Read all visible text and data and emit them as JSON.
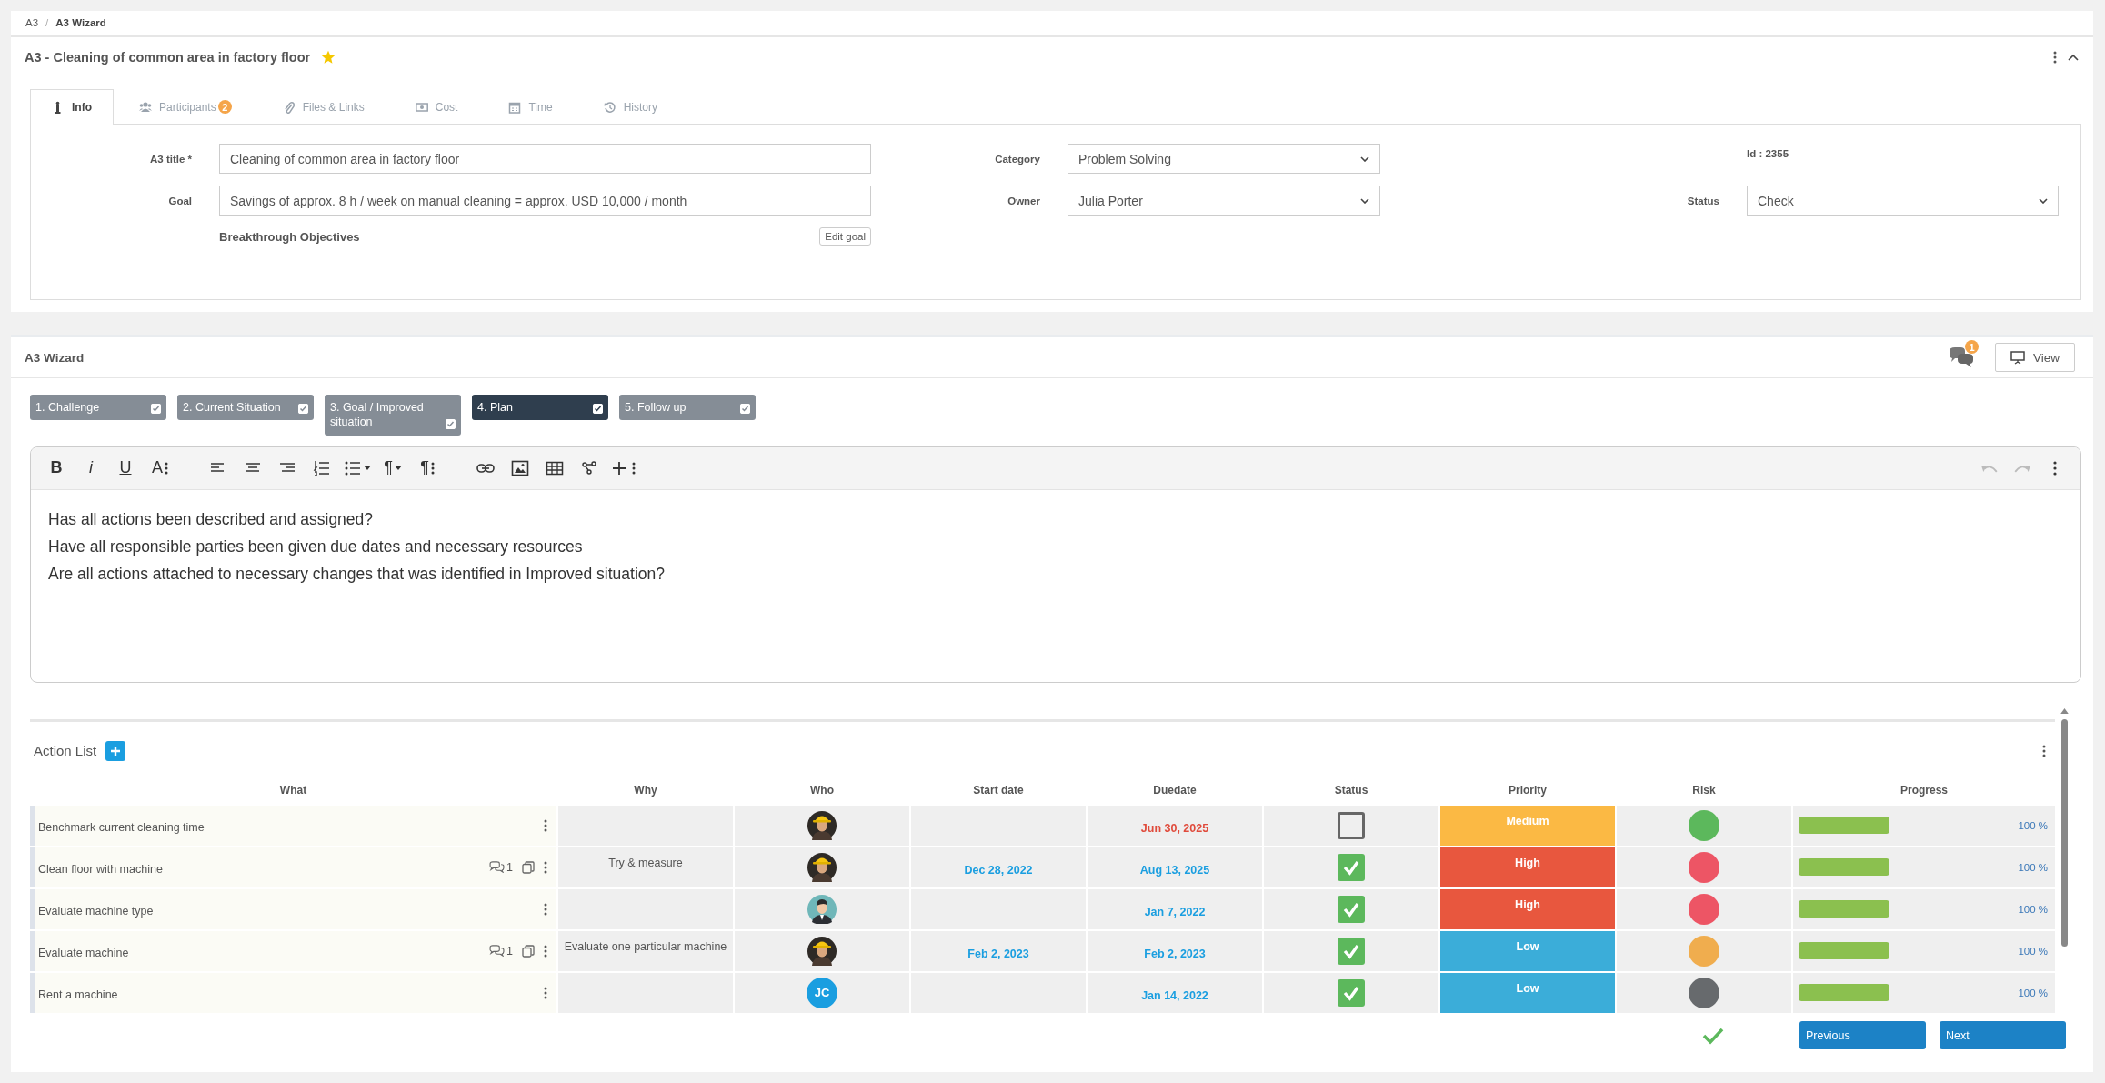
{
  "breadcrumb": {
    "separator": "/",
    "items": [
      {
        "label": "A3",
        "current": false
      },
      {
        "label": "A3 Wizard",
        "current": true
      }
    ]
  },
  "header": {
    "title": "A3 - Cleaning of common area in factory floor",
    "starred": true
  },
  "tabs": [
    {
      "label": "Info",
      "kind": "info",
      "selected": true
    },
    {
      "label": "Participants",
      "kind": "people",
      "badge": "2",
      "selected": false
    },
    {
      "label": "Files & Links",
      "kind": "paperclip",
      "selected": false
    },
    {
      "label": "Cost",
      "kind": "money",
      "selected": false
    },
    {
      "label": "Time",
      "kind": "calendar",
      "selected": false
    },
    {
      "label": "History",
      "kind": "history",
      "selected": false
    }
  ],
  "form": {
    "title_label": "A3 title *",
    "title_value": "Cleaning of common area in factory floor",
    "goal_label": "Goal",
    "goal_value": "Savings of approx. 8 h / week on manual cleaning = approx. USD 10,000 / month",
    "objectives_label": "Breakthrough Objectives",
    "edit_goal": "Edit goal",
    "category_label": "Category",
    "category_value": "Problem Solving",
    "owner_label": "Owner",
    "owner_value": "Julia Porter",
    "id": "Id : 2355",
    "status_label": "Status",
    "status_value": "Check"
  },
  "wizard": {
    "title": "A3 Wizard",
    "comment_badge": "1",
    "view_button": "View",
    "steps": [
      {
        "label": "1. Challenge",
        "checked": true,
        "selected": false
      },
      {
        "label": "2. Current Situation",
        "checked": true,
        "selected": false
      },
      {
        "label": "3. Goal / Improved situation",
        "checked": true,
        "selected": false
      },
      {
        "label": "4. Plan",
        "checked": true,
        "selected": true
      },
      {
        "label": "5. Follow up",
        "checked": true,
        "selected": false
      }
    ]
  },
  "editor": {
    "toolbar": [
      [
        {
          "kind": "bold",
          "glyph": "B"
        },
        {
          "kind": "italic",
          "glyph": "i"
        },
        {
          "kind": "underline",
          "glyph": "U"
        },
        {
          "kind": "font-size",
          "glyph": "A",
          "more": true
        }
      ],
      [
        {
          "kind": "align-left"
        },
        {
          "kind": "align-center"
        },
        {
          "kind": "align-right"
        },
        {
          "kind": "ordered-list"
        },
        {
          "kind": "bullet-list",
          "dropdown": true
        },
        {
          "kind": "paragraph-format",
          "glyph": "¶",
          "dropdown": true
        },
        {
          "kind": "paragraph-style",
          "glyph": "¶",
          "more": true
        }
      ],
      [
        {
          "kind": "link"
        },
        {
          "kind": "image"
        },
        {
          "kind": "table"
        },
        {
          "kind": "nodes"
        },
        {
          "kind": "insert",
          "more": true
        }
      ]
    ],
    "toolbar_right": [
      {
        "kind": "undo",
        "disabled": true
      },
      {
        "kind": "redo",
        "disabled": true
      },
      {
        "kind": "more",
        "disabled": false
      }
    ],
    "lines": [
      "Has all actions been described and assigned?",
      "Have all responsible parties been given due dates and necessary resources",
      "Are all actions attached to necessary changes that was identified in Improved situation?"
    ]
  },
  "action_list": {
    "title": "Action List",
    "columns": [
      "What",
      "Why",
      "Who",
      "Start date",
      "Duedate",
      "Status",
      "Priority",
      "Risk",
      "Progress"
    ],
    "rows": [
      {
        "what": "Benchmark current cleaning time",
        "who": {
          "kind": "worker"
        },
        "due": "Jun 30, 2025",
        "overdue": true,
        "done": false,
        "priority": {
          "label": "Medium",
          "color": "#fbb944"
        },
        "risk": {
          "color": "#5cb85c"
        },
        "level": 1,
        "reading": "100 %"
      },
      {
        "what": "Clean floor with machine",
        "comments": "1",
        "why": "Try & measure",
        "who": {
          "kind": "worker"
        },
        "start": "Dec 28, 2022",
        "due": "Aug 13, 2025",
        "overdue": false,
        "done": true,
        "priority": {
          "label": "High",
          "color": "#e8573e"
        },
        "risk": {
          "color": "#ed5565"
        },
        "level": 1,
        "reading": "100 %"
      },
      {
        "what": "Evaluate machine type",
        "who": {
          "kind": "man"
        },
        "due": "Jan 7, 2022",
        "overdue": false,
        "done": true,
        "priority": {
          "label": "High",
          "color": "#e8573e"
        },
        "risk": {
          "color": "#ed5565"
        },
        "level": 1,
        "reading": "100 %"
      },
      {
        "what": "Evaluate machine",
        "comments": "1",
        "why": "Evaluate one particular machine",
        "who": {
          "kind": "worker"
        },
        "start": "Feb 2, 2023",
        "due": "Feb 2, 2023",
        "overdue": false,
        "done": true,
        "priority": {
          "label": "Low",
          "color": "#3badd9"
        },
        "risk": {
          "color": "#f0ad4e"
        },
        "level": 1,
        "reading": "100 %"
      },
      {
        "what": "Rent a machine",
        "who": {
          "kind": "initials",
          "initials": "JC"
        },
        "due": "Jan 14, 2022",
        "overdue": false,
        "done": true,
        "priority": {
          "label": "Low",
          "color": "#3badd9"
        },
        "risk": {
          "color": "#676a6d"
        },
        "level": 1,
        "reading": "100 %"
      }
    ]
  },
  "footer": {
    "saved": true,
    "previous": "Previous",
    "next": "Next"
  }
}
